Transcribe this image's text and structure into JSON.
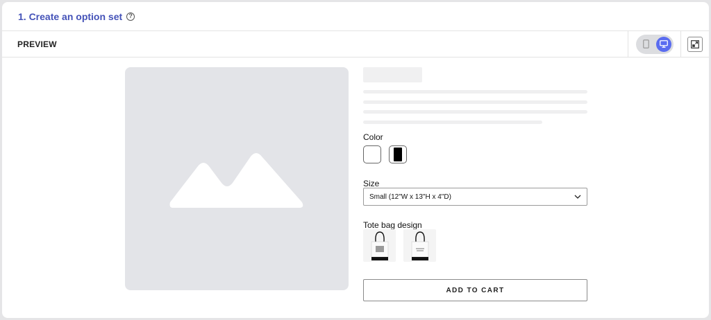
{
  "section": {
    "title": "1. Create an option set",
    "help_icon": "help-circle-icon",
    "help_glyph": "?"
  },
  "preview": {
    "label": "PREVIEW",
    "device_toggle": {
      "options": [
        "mobile",
        "desktop"
      ],
      "selected": "desktop",
      "accent": "#5a6cf0"
    },
    "expand_icon": "expand-icon"
  },
  "product": {
    "image_icon": "image-placeholder-icon",
    "options": {
      "color": {
        "label": "Color",
        "swatches": [
          {
            "name": "white",
            "color": "#ffffff"
          },
          {
            "name": "black",
            "color": "#000000"
          }
        ]
      },
      "size": {
        "label": "Size",
        "selected": "Small (12\"W x 13\"H x 4\"D)"
      },
      "design": {
        "label": "Tote bag design",
        "thumbnails": [
          "tote-bag-design-1",
          "tote-bag-design-2"
        ]
      }
    },
    "add_to_cart_label": "ADD TO CART"
  }
}
